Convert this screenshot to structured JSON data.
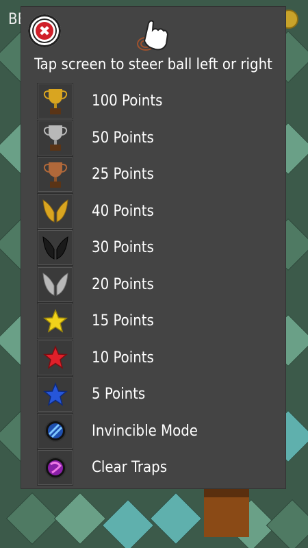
{
  "background": {
    "corner_label": "BE"
  },
  "panel": {
    "close_label": "✖",
    "instruction": "Tap screen to steer ball left or right",
    "items": [
      {
        "icon": "gold-trophy-icon",
        "label": "100 Points"
      },
      {
        "icon": "silver-trophy-icon",
        "label": "50 Points"
      },
      {
        "icon": "bronze-trophy-icon",
        "label": "25 Points"
      },
      {
        "icon": "gold-wings-icon",
        "label": "40 Points"
      },
      {
        "icon": "black-wings-icon",
        "label": "30 Points"
      },
      {
        "icon": "silver-wings-icon",
        "label": "20 Points"
      },
      {
        "icon": "yellow-star-icon",
        "label": "15 Points"
      },
      {
        "icon": "red-star-icon",
        "label": "10 Points"
      },
      {
        "icon": "blue-star-icon",
        "label": "5 Points"
      },
      {
        "icon": "invincible-orb-icon",
        "label": "Invincible Mode"
      },
      {
        "icon": "clear-traps-orb-icon",
        "label": "Clear Traps"
      }
    ]
  },
  "colors": {
    "panel_bg": "#444444",
    "gold": "#d9a520",
    "silver": "#b8b8b8",
    "bronze": "#b0683a",
    "red_star": "#e0202a",
    "blue_star": "#2656d9",
    "yellow_star": "#f2d21a"
  }
}
